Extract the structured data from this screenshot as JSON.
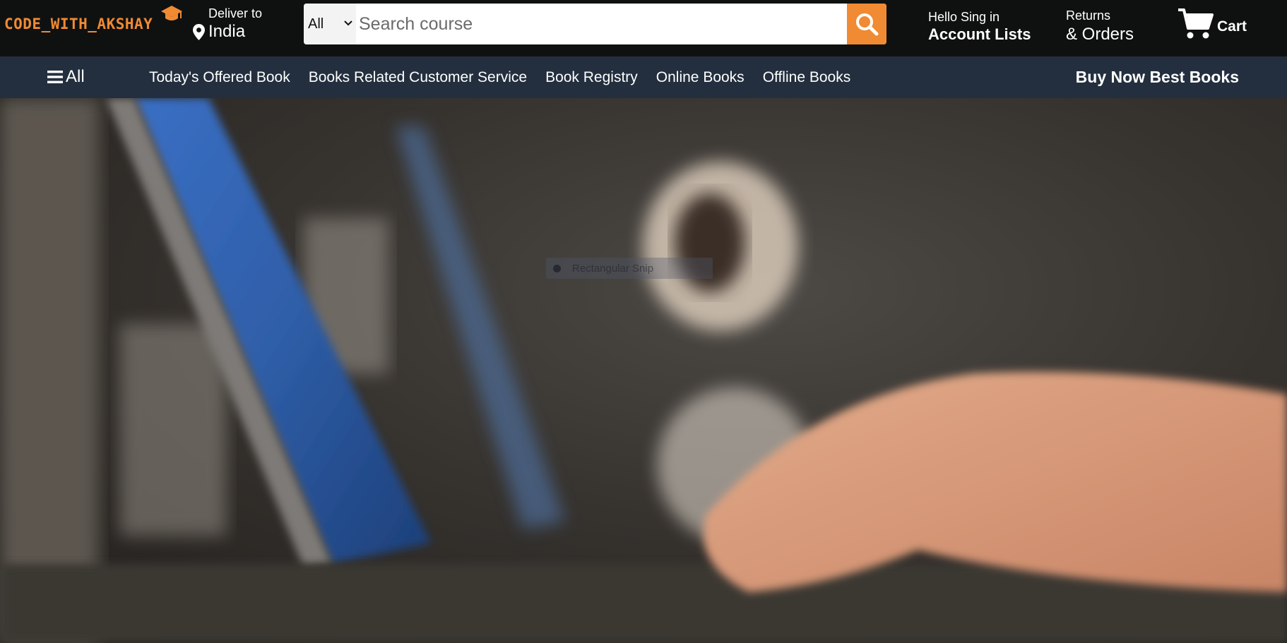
{
  "brand": {
    "logo_text": "CODE_WITH_AKSHAY"
  },
  "deliver": {
    "label": "Deliver to",
    "location": "India"
  },
  "search": {
    "category": "All",
    "placeholder": "Search course"
  },
  "account": {
    "greeting": "Hello Sing in",
    "lists": "Account Lists"
  },
  "returns": {
    "line1": "Returns",
    "line2": "& Orders"
  },
  "cart": {
    "label": "Cart"
  },
  "subnav": {
    "all_label": "All",
    "links": [
      "Today's Offered Book",
      "Books Related Customer Service",
      "Book Registry",
      "Online Books",
      "Offline Books"
    ],
    "promo": "Buy Now Best Books"
  },
  "hero": {
    "overlay_text": "Rectangular Snip"
  },
  "colors": {
    "accent": "#f08a33",
    "topbar": "#0f1111",
    "subnav": "#232f3e"
  },
  "icons": [
    "graduation-cap-icon",
    "location-pin-icon",
    "chevron-down-icon",
    "search-icon",
    "cart-icon",
    "menu-icon"
  ]
}
